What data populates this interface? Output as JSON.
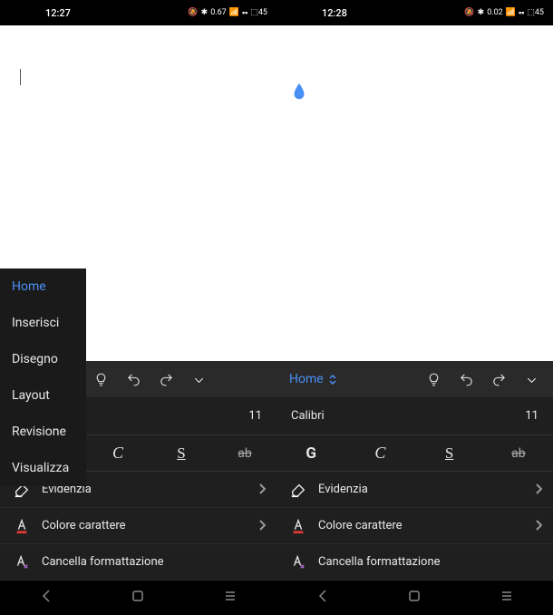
{
  "status": {
    "time_left": "12:27",
    "time_right": "12:28",
    "net_left": "0.67",
    "net_right": "0.02",
    "battery": "45"
  },
  "sidebar": {
    "items": [
      {
        "label": "Home",
        "active": true
      },
      {
        "label": "Inserisci",
        "active": false
      },
      {
        "label": "Disegno",
        "active": false
      },
      {
        "label": "Layout",
        "active": false
      },
      {
        "label": "Revisione",
        "active": false
      },
      {
        "label": "Visualizza",
        "active": false
      }
    ]
  },
  "panel": {
    "tab_label": "Home",
    "font_name": "Calibri",
    "font_size": "11",
    "format": {
      "bold": "G",
      "italic": "C",
      "underline": "S",
      "strike": "ab"
    },
    "actions": {
      "highlight": "Evidenzia",
      "font_color": "Colore carattere",
      "clear_format": "Cancella formattazione"
    }
  }
}
